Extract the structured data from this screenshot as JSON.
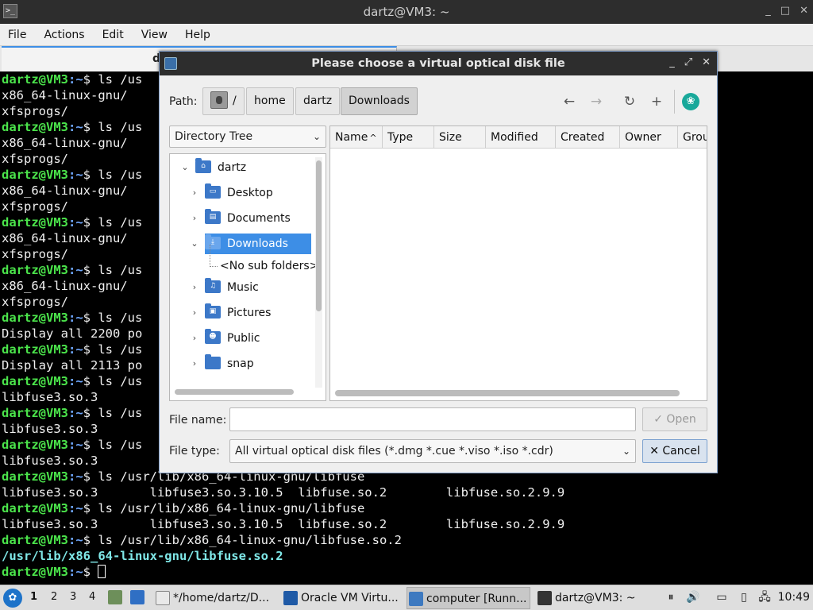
{
  "terminal": {
    "window_title": "dartz@VM3: ~",
    "app_icon": ">_",
    "window_buttons": [
      "_",
      "□",
      "✕"
    ],
    "menu": [
      "File",
      "Actions",
      "Edit",
      "View",
      "Help"
    ],
    "tab_label": "d",
    "prompt": "dartz@VM3",
    "path": ":~",
    "lines": [
      {
        "type": "cmd",
        "text": "$ ls /us"
      },
      {
        "type": "out",
        "text": "x86_64-linux-gnu/"
      },
      {
        "type": "out",
        "text": "xfsprogs/"
      },
      {
        "type": "cmd",
        "text": "$ ls /us"
      },
      {
        "type": "out",
        "text": "x86_64-linux-gnu/"
      },
      {
        "type": "out",
        "text": "xfsprogs/"
      },
      {
        "type": "cmd",
        "text": "$ ls /us"
      },
      {
        "type": "out",
        "text": "x86_64-linux-gnu/"
      },
      {
        "type": "out",
        "text": "xfsprogs/"
      },
      {
        "type": "cmd",
        "text": "$ ls /us"
      },
      {
        "type": "out",
        "text": "x86_64-linux-gnu/"
      },
      {
        "type": "out",
        "text": "xfsprogs/"
      },
      {
        "type": "cmd",
        "text": "$ ls /us"
      },
      {
        "type": "out",
        "text": "x86_64-linux-gnu/"
      },
      {
        "type": "out",
        "text": "xfsprogs/"
      },
      {
        "type": "cmd",
        "text": "$ ls /us"
      },
      {
        "type": "out",
        "text": "Display all 2200 po"
      },
      {
        "type": "cmd",
        "text": "$ ls /us"
      },
      {
        "type": "out",
        "text": "Display all 2113 po"
      },
      {
        "type": "cmd",
        "text": "$ ls /us"
      },
      {
        "type": "out",
        "text": "libfuse3.so.3"
      },
      {
        "type": "cmd",
        "text": "$ ls /us"
      },
      {
        "type": "out",
        "text": "libfuse3.so.3"
      },
      {
        "type": "cmd",
        "text": "$ ls /us"
      },
      {
        "type": "out",
        "text": "libfuse3.so.3"
      },
      {
        "type": "cmd",
        "text": "$ ls /usr/lib/x86_64-linux-gnu/libfuse"
      },
      {
        "type": "out",
        "text": "libfuse3.so.3       libfuse3.so.3.10.5  libfuse.so.2        libfuse.so.2.9.9"
      },
      {
        "type": "cmd",
        "text": "$ ls /usr/lib/x86_64-linux-gnu/libfuse"
      },
      {
        "type": "out",
        "text": "libfuse3.so.3       libfuse3.so.3.10.5  libfuse.so.2        libfuse.so.2.9.9"
      },
      {
        "type": "cmd",
        "text": "$ ls /usr/lib/x86_64-linux-gnu/libfuse.so.2"
      },
      {
        "type": "link",
        "text": "/usr/lib/x86_64-linux-gnu/libfuse.so.2"
      },
      {
        "type": "cursor",
        "text": "$ "
      }
    ],
    "colors": {
      "prompt": "#4be44b",
      "path": "#6fa8ff",
      "link": "#7fe7e7"
    }
  },
  "dialog": {
    "title": "Please choose a virtual optical disk file",
    "title_buttons": [
      "_",
      "⤢",
      "✕"
    ],
    "path_label": "Path:",
    "breadcrumbs": [
      "/",
      "home",
      "dartz",
      "Downloads"
    ],
    "active_crumb": "Downloads",
    "nav": {
      "back": "←",
      "forward": "→",
      "refresh": "↻",
      "new_folder": "+"
    },
    "tree_combo": "Directory Tree",
    "tree": [
      {
        "label": "dartz",
        "expander": "⌄",
        "glyph": "⌂",
        "level": 0
      },
      {
        "label": "Desktop",
        "expander": "›",
        "glyph": "▭",
        "level": 1
      },
      {
        "label": "Documents",
        "expander": "›",
        "glyph": "▤",
        "level": 1
      },
      {
        "label": "Downloads",
        "expander": "⌄",
        "glyph": "⤓",
        "level": 1,
        "selected": true
      },
      {
        "label": "<No sub folders>",
        "expander": "",
        "glyph": "",
        "level": 2
      },
      {
        "label": "Music",
        "expander": "›",
        "glyph": "♫",
        "level": 1
      },
      {
        "label": "Pictures",
        "expander": "›",
        "glyph": "▣",
        "level": 1
      },
      {
        "label": "Public",
        "expander": "›",
        "glyph": "☻",
        "level": 1
      },
      {
        "label": "snap",
        "expander": "›",
        "glyph": "",
        "level": 1
      }
    ],
    "columns": [
      "Name",
      "Type",
      "Size",
      "Modified",
      "Created",
      "Owner",
      "Grou"
    ],
    "sort_indicator": "^",
    "file_name_label": "File name:",
    "file_name_value": "",
    "open_button": "Open",
    "open_check": "✓",
    "file_type_label": "File type:",
    "file_type_value": "All virtual optical disk files (*.dmg *.cue *.viso *.iso *.cdr)",
    "cancel_button": "Cancel",
    "cancel_x": "✕",
    "accent_color": "#3d8ee6"
  },
  "taskbar": {
    "workspaces": [
      "1",
      "2",
      "3",
      "4"
    ],
    "tasks": [
      {
        "label": "*/home/dartz/D...",
        "icon": "text-editor-icon",
        "active": false
      },
      {
        "label": "Oracle VM Virtu...",
        "icon": "virtualbox-icon",
        "active": false
      },
      {
        "label": "computer [Runn...",
        "icon": "vm-running-icon",
        "active": true
      },
      {
        "label": "dartz@VM3: ~",
        "icon": "terminal-icon",
        "active": false
      }
    ],
    "tray": [
      "⏸",
      "🔊",
      "▭",
      "▯",
      "🖧"
    ],
    "clock": "10:49"
  }
}
